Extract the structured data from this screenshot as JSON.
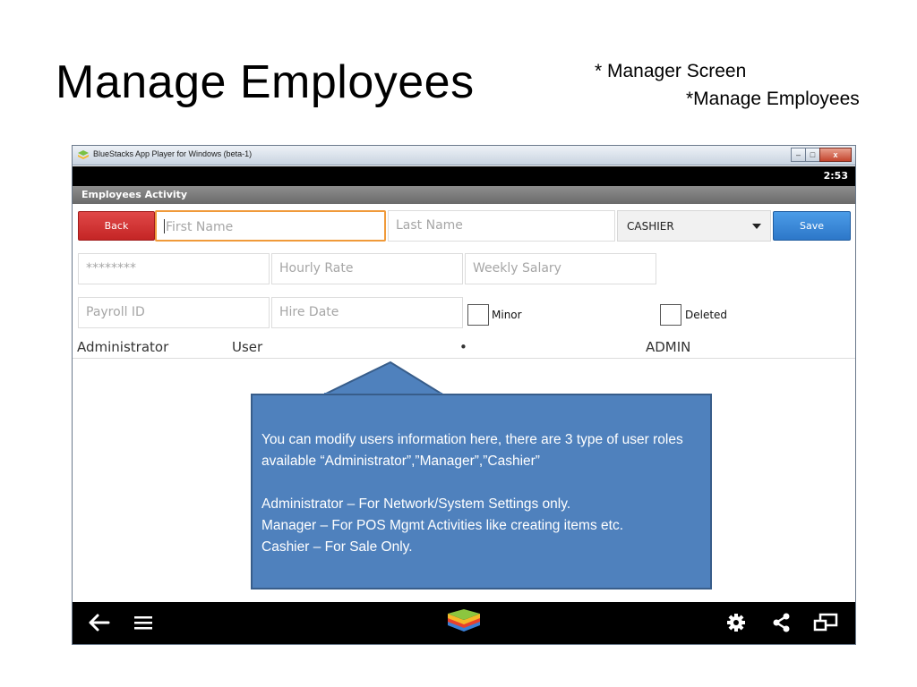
{
  "slide": {
    "title": "Manage Employees",
    "note_line1": "* Manager Screen",
    "note_line2": "*Manage Employees"
  },
  "window": {
    "title": "BlueStacks App Player for Windows (beta-1)",
    "controls": {
      "minimize": "–",
      "maximize": "□",
      "close": "x"
    }
  },
  "status_bar": {
    "time": "2:53"
  },
  "action_bar": {
    "title": "Employees Activity"
  },
  "form": {
    "back_label": "Back",
    "save_label": "Save",
    "first_name_placeholder": "First Name",
    "last_name_placeholder": "Last Name",
    "role_selected": "CASHIER",
    "password_value": "********",
    "hourly_rate_placeholder": "Hourly Rate",
    "weekly_salary_placeholder": "Weekly Salary",
    "payroll_id_placeholder": "Payroll ID",
    "hire_date_placeholder": "Hire Date",
    "minor_label": "Minor",
    "deleted_label": "Deleted"
  },
  "employee_list": [
    {
      "name": "Administrator",
      "type": "User",
      "marker": "•",
      "role": "ADMIN"
    }
  ],
  "callout": {
    "line1": "You can modify users information here, there are 3 type of user roles available “Administrator”,”Manager”,”Cashier”",
    "line2": "Administrator – For Network/System Settings only.",
    "line3": "Manager – For POS Mgmt Activities like creating items etc.",
    "line4": "Cashier – For Sale Only."
  },
  "colors": {
    "back_button": "#d43333",
    "save_button": "#3a86d6",
    "focus_border": "#f09a3a",
    "callout_fill": "#4f81bd",
    "callout_border": "#385d8a"
  },
  "icons": [
    "back-arrow-icon",
    "menu-icon",
    "bluestacks-logo-icon",
    "settings-icon",
    "share-icon",
    "multi-window-icon"
  ]
}
